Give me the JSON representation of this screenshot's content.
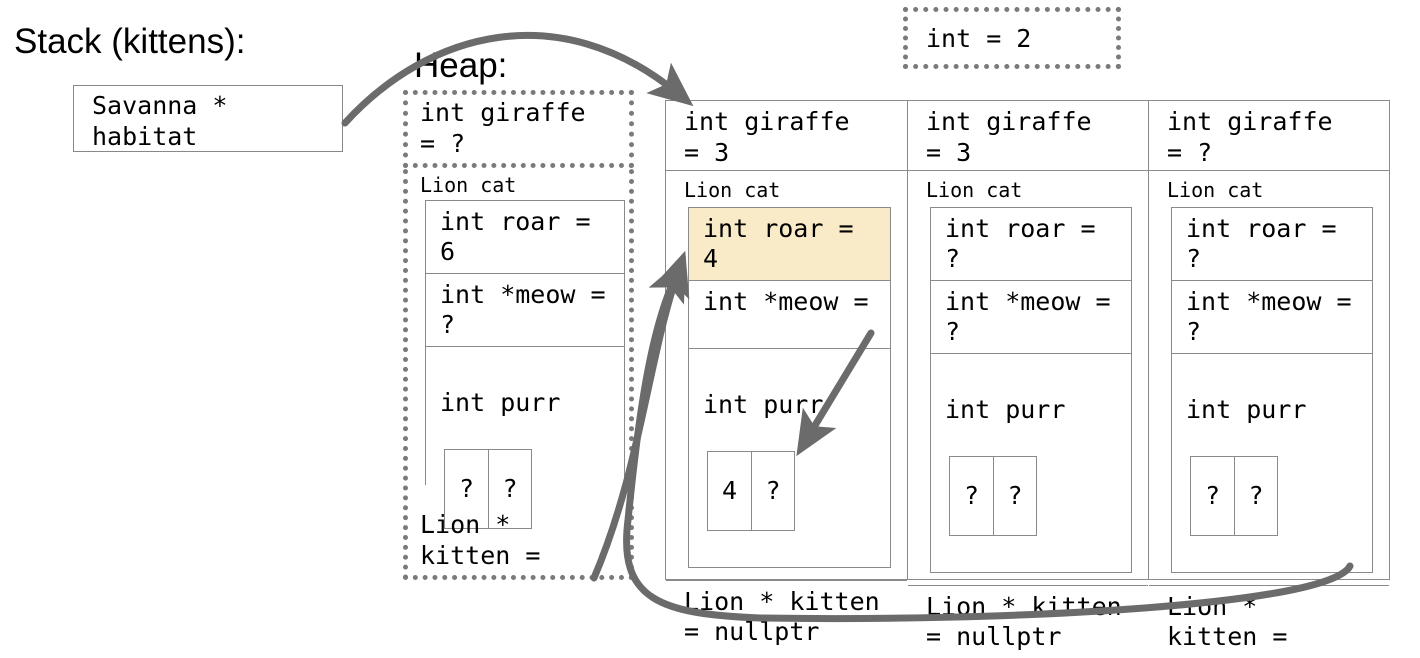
{
  "stack": {
    "title": "Stack (kittens):",
    "variable": "Savanna *\nhabitat"
  },
  "heap": {
    "title": "Heap:",
    "giraffe": "int giraffe\n= ?",
    "object_label": "Lion cat",
    "fields": [
      {
        "text": "int roar =\n6"
      },
      {
        "text": "int *meow =\n?"
      }
    ],
    "array_label": "int purr",
    "array_cells": [
      "?",
      "?"
    ],
    "kitten": "Lion *\nkitten ="
  },
  "floating_int": {
    "text": "int = 2"
  },
  "columns": [
    {
      "giraffe": "int giraffe\n= 3",
      "object_label": "Lion cat",
      "roar": "int roar =\n4",
      "roar_highlighted": true,
      "meow": "int *meow =",
      "array_label": "int purr",
      "array_cells": [
        "4",
        "?"
      ],
      "kitten": "Lion * kitten\n= nullptr"
    },
    {
      "giraffe": "int giraffe\n= 3",
      "object_label": "Lion cat",
      "roar": "int roar =\n?",
      "roar_highlighted": false,
      "meow": "int *meow =\n?",
      "array_label": "int purr",
      "array_cells": [
        "?",
        "?"
      ],
      "kitten": "Lion * kitten\n= nullptr"
    },
    {
      "giraffe": "int giraffe\n= ?",
      "object_label": "Lion cat",
      "roar": "int roar =\n?",
      "roar_highlighted": false,
      "meow": "int *meow =\n?",
      "array_label": "int purr",
      "array_cells": [
        "?",
        "?"
      ],
      "kitten": "Lion *\nkitten ="
    }
  ],
  "colors": {
    "highlight": "#faebc8",
    "arrow": "#6b6b6b",
    "border": "#8a8a8a",
    "dashed": "#7a7a7a"
  }
}
